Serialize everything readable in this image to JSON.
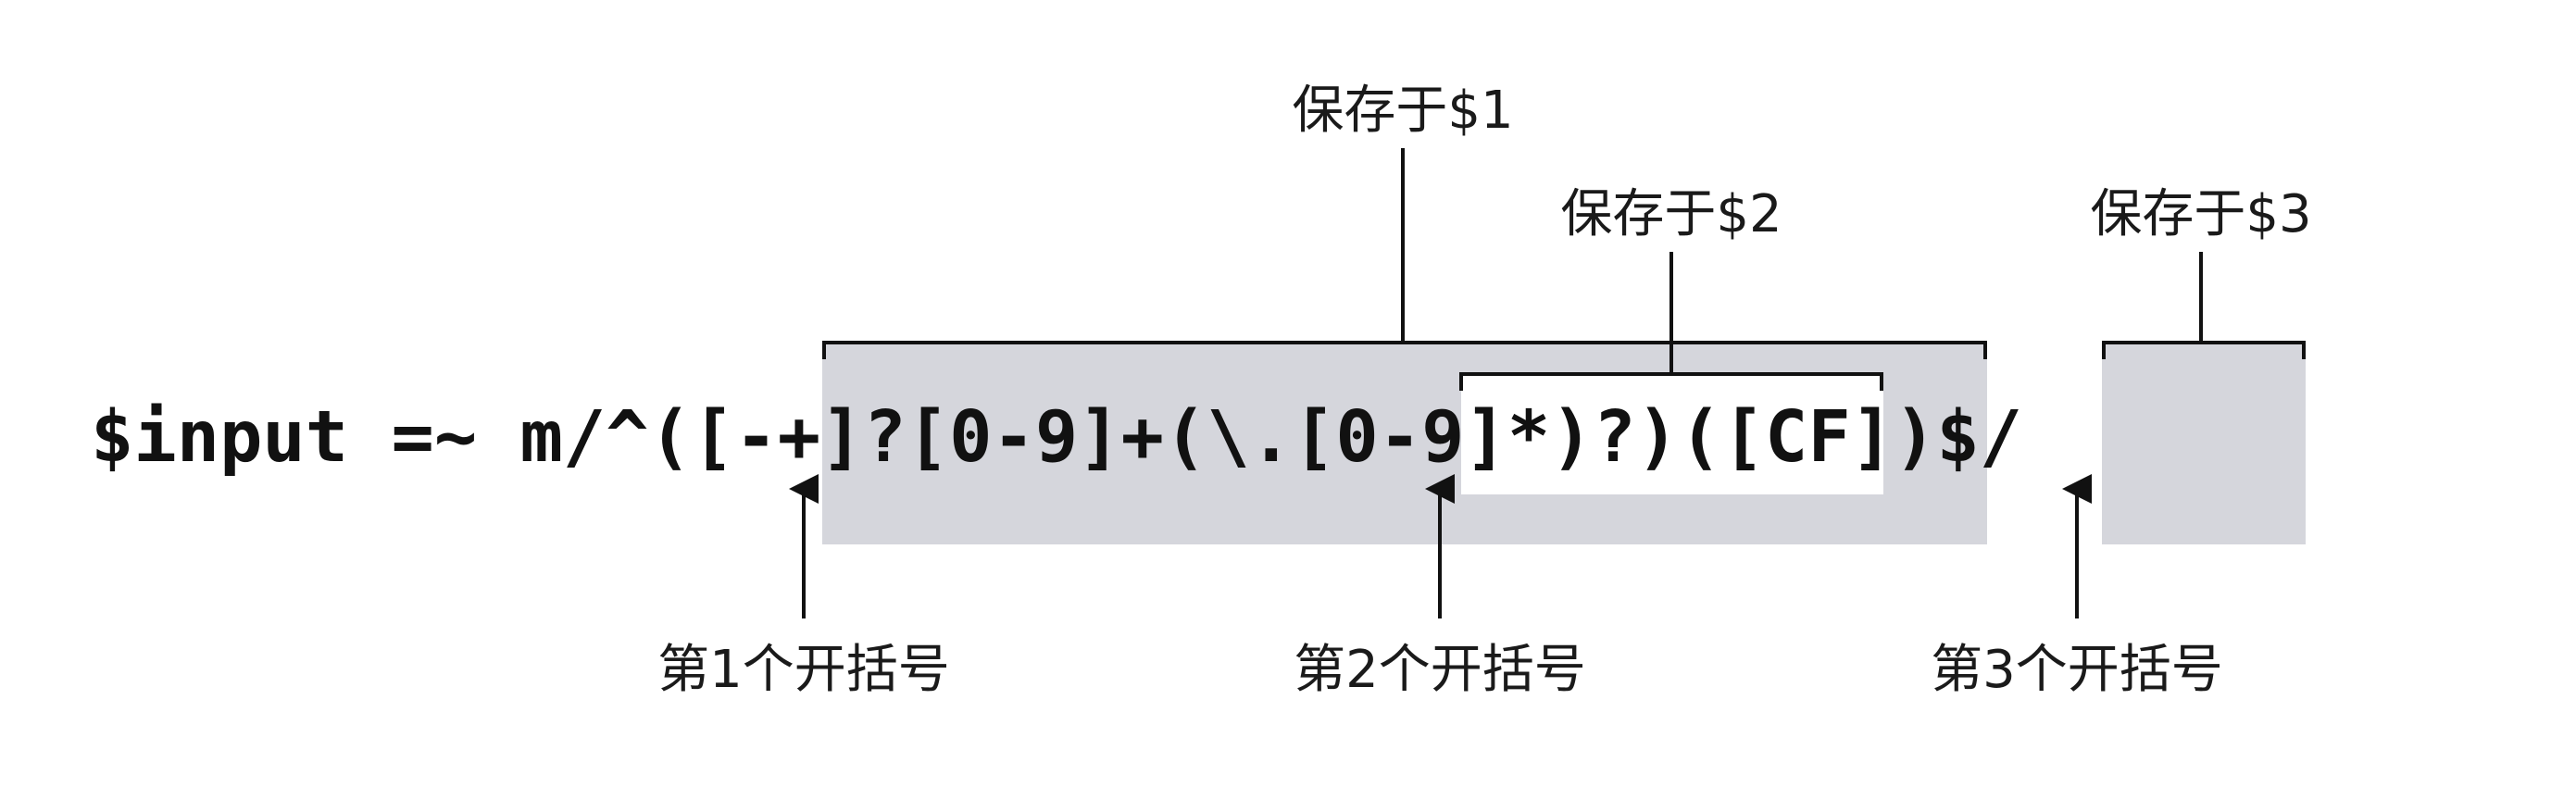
{
  "code": {
    "prefix": "$input =~ m/^",
    "open1": "(",
    "group1_text": "[-+]?[0-9]+",
    "open2": "(",
    "group2_text": "\\.[0-9]*",
    "close2_q": ")?",
    "close1": ")",
    "open3": "(",
    "group3_text": "[CF]",
    "close3": ")",
    "suffix": "$/"
  },
  "labels": {
    "saved1": "保存于$1",
    "saved2": "保存于$2",
    "saved3": "保存于$3",
    "paren1": "第1个开括号",
    "paren2": "第2个开括号",
    "paren3": "第3个开括号"
  }
}
